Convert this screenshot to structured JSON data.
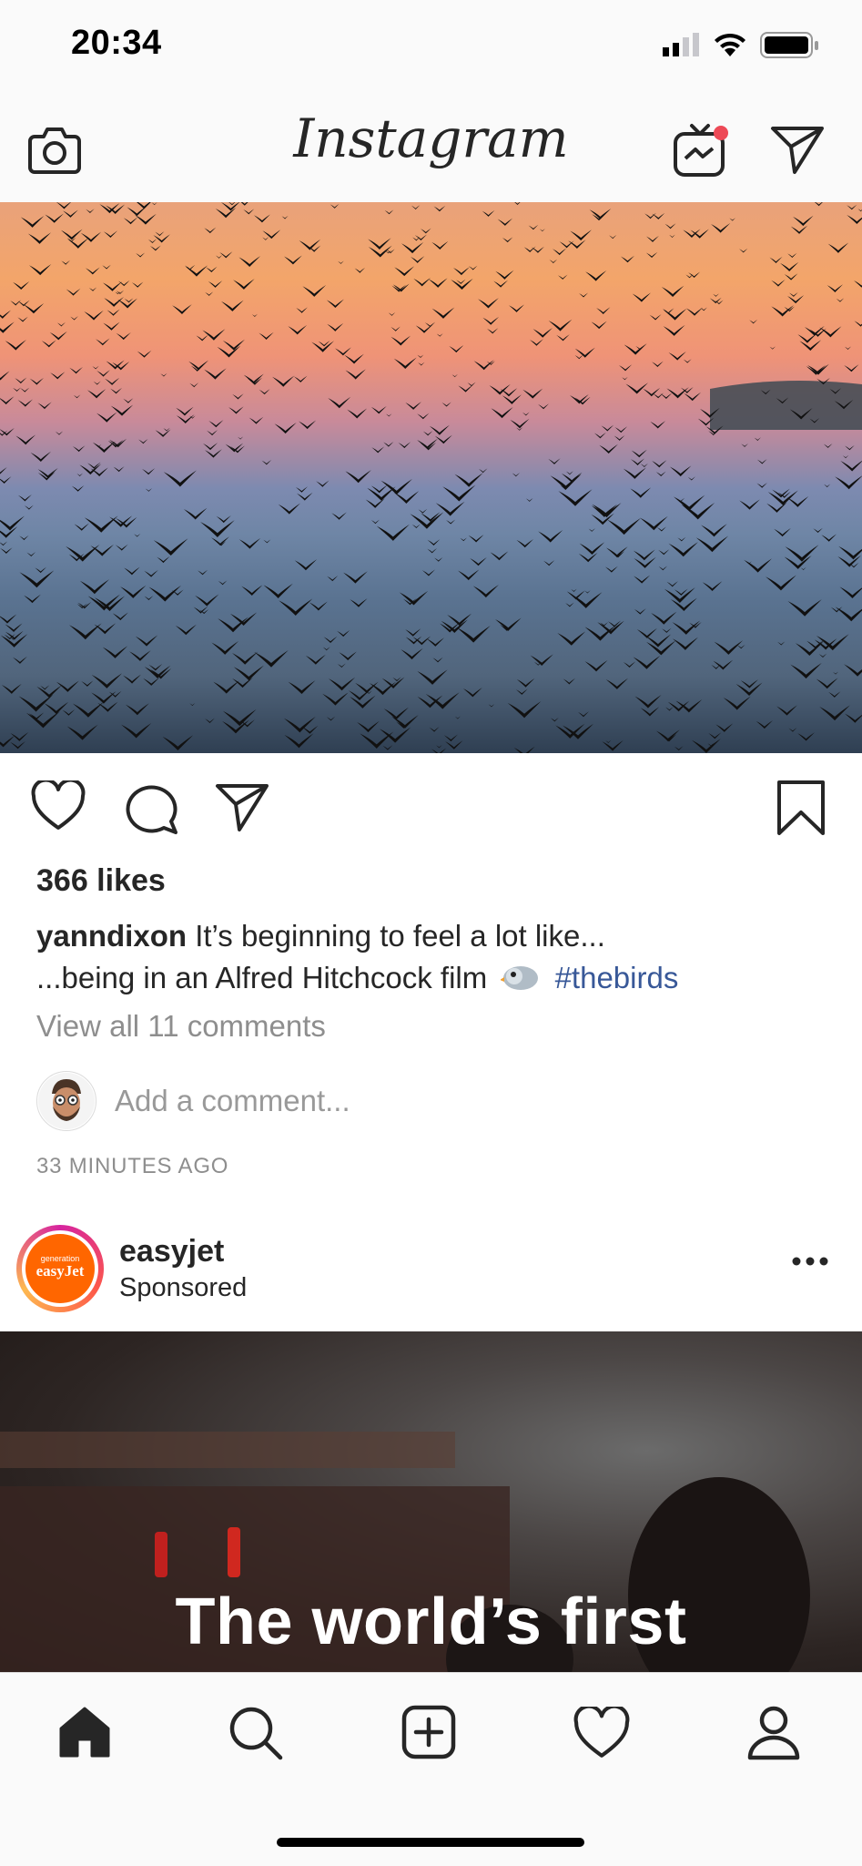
{
  "status_bar": {
    "time": "20:34"
  },
  "header": {
    "app_title": "Instagram"
  },
  "post1": {
    "likes": "366 likes",
    "username": "yanndixon",
    "caption_line1": "It’s beginning to feel a lot like...",
    "caption_line2": "...being in an Alfred Hitchcock film",
    "hashtag": "#thebirds",
    "view_comments": "View all 11 comments",
    "add_comment_placeholder": "Add a comment...",
    "time_ago": "33 MINUTES AGO"
  },
  "post2": {
    "username": "easyjet",
    "label": "Sponsored",
    "logo_small_text": "generation",
    "logo_text": "easyJet",
    "overlay_text": "The world’s first"
  },
  "tabbar": {
    "items": [
      "home-icon",
      "search-icon",
      "new-post-icon",
      "activity-heart-icon",
      "profile-icon"
    ]
  },
  "colors": {
    "accent_link": "#385898",
    "notification_dot": "#ed4956",
    "easyjet_orange": "#ff6600"
  }
}
